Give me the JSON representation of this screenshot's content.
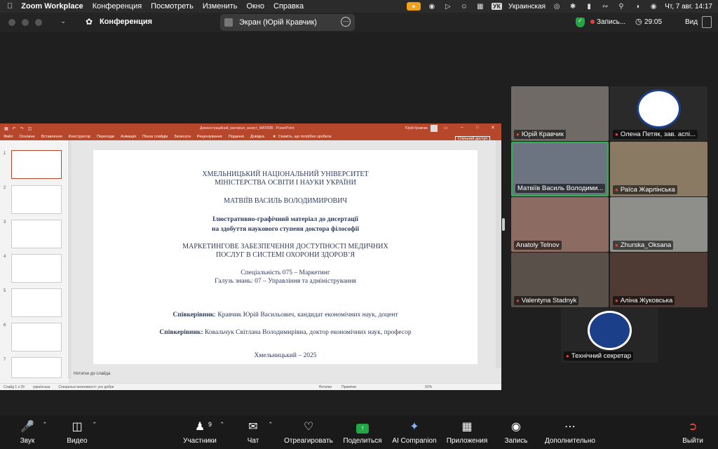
{
  "menubar": {
    "app": "Zoom Workplace",
    "items": [
      "Конференция",
      "Посмотреть",
      "Изменить",
      "Окно",
      "Справка"
    ],
    "lang_badge": "УК",
    "lang": "Украинская",
    "datetime": "Чт, 7 авг.  14:17"
  },
  "titlebar": {
    "title": "Конференция",
    "share_label": "Экран (Юрій Кравчик)",
    "recording": "Запись...",
    "timer": "29:05",
    "view": "Вид"
  },
  "ppt": {
    "file": "Демонстраційний_матеріал_захист_МАТВІЇВ  -  PowerPoint",
    "user": "Юрій Кравчик",
    "tabs": [
      "Файл",
      "Основне",
      "Вставлення",
      "Конструктор",
      "Переходи",
      "Анімація",
      "Показ слайдів",
      "Записати",
      "Рецензування",
      "Подання",
      "Довідка"
    ],
    "search": "Скажіть, що потрібно зробити",
    "share": "Спільний доступ",
    "thumb_numbers": [
      "1",
      "2",
      "3",
      "4",
      "5",
      "6",
      "7"
    ],
    "notes": "Нотатки до слайда",
    "status_left": "Слайд 1 з 29",
    "status_lang": "українська",
    "status_access": "Спеціальні можливості: усе добре",
    "status_notes": "Нотатки",
    "status_comments": "Примітки",
    "zoom": "92%"
  },
  "slide": {
    "univ1": "ХМЕЛЬНИЦЬКИЙ НАЦІОНАЛЬНИЙ УНІВЕРСИТЕТ",
    "univ2": "МІНІСТЕРСТВА ОСВІТИ І НАУКИ УКРАЇНИ",
    "author": "МАТВІЇВ ВАСИЛЬ ВОЛОДИМИРОВИЧ",
    "sub1": "Ілюстративно-графічний матеріал до дисертації",
    "sub2": "на здобуття наукового ступеня доктора філософії",
    "topic1": "МАРКЕТИНГОВЕ ЗАБЕЗПЕЧЕННЯ ДОСТУПНОСТІ МЕДИЧНИХ",
    "topic2": "ПОСЛУГ В СИСТЕМІ ОХОРОНИ ЗДОРОВ’Я",
    "spec": "Спеціальність 075 – Маркетинг",
    "field": "Галузь знань: 07 – Управління та адміністрування",
    "sup_label": "Співкерівник",
    "sup1": ": Кравчик Юрій Васильович, кандидат економічних наук, доцент",
    "sup2": " Ковальчук Світлана Володимирівна, доктор економічних наук, професор",
    "city": "Хмельницький – 2025"
  },
  "participants": [
    {
      "name": "Юрій Кравчик",
      "bg": "#6f6a66"
    },
    {
      "name": "Олена Петяк, зав. аспі...",
      "bg": "#2a2a2a"
    },
    {
      "name": "Матвіїв Василь Володими...",
      "bg": "#6b7480"
    },
    {
      "name": "Раїса Жарлінська",
      "bg": "#8a7a63"
    },
    {
      "name": "Anatoly Telnov",
      "bg": "#8c6c62"
    },
    {
      "name": "Zhurska_Oksana",
      "bg": "#8e8f8a"
    },
    {
      "name": "Valentyna Stadnyk",
      "bg": "#5a504a"
    },
    {
      "name": "Аліна Жуковська",
      "bg": "#4f3a34"
    },
    {
      "name": "Технічний секретар",
      "bg": "#262626"
    }
  ],
  "toolbar": {
    "audio": "Звук",
    "video": "Видео",
    "participants": "Участники",
    "participants_count": "9",
    "chat": "Чат",
    "react": "Отреагировать",
    "share": "Поделиться",
    "ai": "AI Companion",
    "apps": "Приложения",
    "record": "Запись",
    "more": "Дополнительно",
    "leave": "Выйти"
  },
  "colors": {
    "ppt_accent": "#b7472a",
    "share_green": "#23a745",
    "speaker_border": "#30b050"
  }
}
